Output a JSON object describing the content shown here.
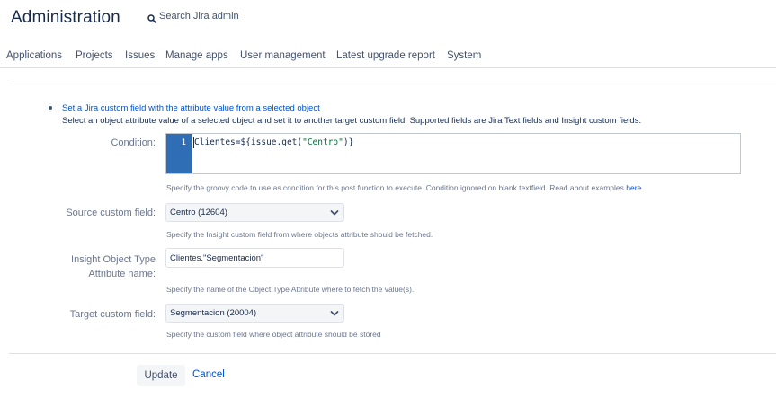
{
  "header": {
    "title": "Administration",
    "search_label": "Search Jira admin",
    "search_icon": "search-icon"
  },
  "nav": {
    "items": [
      {
        "label": "Applications"
      },
      {
        "label": "Projects"
      },
      {
        "label": "Issues"
      },
      {
        "label": "Manage apps"
      },
      {
        "label": "User management"
      },
      {
        "label": "Latest upgrade report"
      },
      {
        "label": "System"
      }
    ]
  },
  "post_function": {
    "link_text": "Set a Jira custom field with the attribute value from a selected object",
    "description": "Select an object attribute value of a selected object and set it to another target custom field. Supported fields are Jira Text fields and Insight custom fields."
  },
  "condition": {
    "label": "Condition:",
    "line_number": "1",
    "code_prefix": "Clientes=${issue.get(",
    "code_string": "\"Centro\"",
    "code_suffix": ")}",
    "hint_text": "Specify the groovy code to use as condition for this post function to execute. Condition ignored on blank textfield. Read about examples ",
    "hint_link": "here"
  },
  "source_field": {
    "label": "Source custom field:",
    "value": "Centro (12604)",
    "hint": "Specify the Insight custom field from where objects attribute should be fetched."
  },
  "attribute_name": {
    "label_line1": "Insight Object Type",
    "label_line2": "Attribute name:",
    "value": "Clientes.\"Segmentación\"",
    "hint": "Specify the name of the Object Type Attribute where to fetch the value(s)."
  },
  "target_field": {
    "label": "Target custom field:",
    "value": "Segmentacion (20004)",
    "hint": "Specify the custom field where object attribute should be stored"
  },
  "actions": {
    "update_label": "Update",
    "cancel_label": "Cancel"
  },
  "colors": {
    "link": "#0052cc",
    "gutter": "#2f6db5",
    "text": "#172b4d",
    "muted": "#6b778c"
  }
}
